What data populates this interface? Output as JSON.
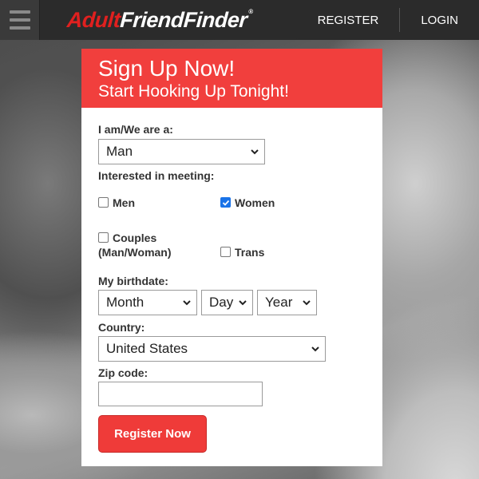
{
  "header": {
    "logo_part1": "Adult",
    "logo_part2": "FriendFinder",
    "logo_mark": "®",
    "nav": {
      "register": "REGISTER",
      "login": "LOGIN"
    }
  },
  "form": {
    "title": "Sign Up Now!",
    "subtitle": "Start Hooking Up Tonight!",
    "iam_label": "I am/We are a:",
    "iam_value": "Man",
    "interested_label": "Interested in meeting:",
    "options": [
      {
        "label": "Men",
        "checked": false
      },
      {
        "label": "Women",
        "checked": true
      },
      {
        "label": "Couples\n(Man/Woman)",
        "label_line1": "Couples",
        "label_line2": "(Man/Woman)",
        "checked": false
      },
      {
        "label": "Trans",
        "checked": false
      }
    ],
    "birthdate_label": "My birthdate:",
    "month_value": "Month",
    "day_value": "Day",
    "year_value": "Year",
    "country_label": "Country:",
    "country_value": "United States",
    "zip_label": "Zip code:",
    "zip_value": "",
    "submit_label": "Register Now"
  },
  "colors": {
    "brand_red": "#f13f3d",
    "topbar": "#2b2b2b",
    "check_blue": "#1a73e8"
  }
}
